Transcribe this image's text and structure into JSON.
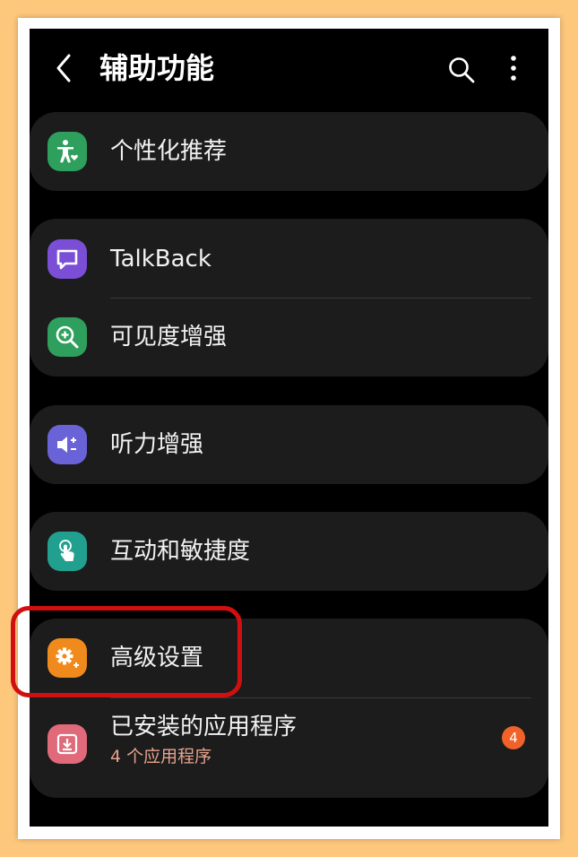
{
  "header": {
    "title": "辅助功能",
    "back_icon": "chevron-left-icon",
    "search_icon": "search-icon",
    "more_icon": "more-vertical-icon"
  },
  "groups": [
    {
      "items": [
        {
          "label": "个性化推荐",
          "icon": "accessibility-heart-icon",
          "icon_color": "#2e9f5c"
        }
      ]
    },
    {
      "items": [
        {
          "label": "TalkBack",
          "icon": "talkback-icon",
          "icon_color": "#7a4fd6"
        },
        {
          "label": "可见度增强",
          "icon": "zoom-in-icon",
          "icon_color": "#2e9f5c"
        }
      ]
    },
    {
      "items": [
        {
          "label": "听力增强",
          "icon": "volume-plus-minus-icon",
          "icon_color": "#6a63d8"
        }
      ]
    },
    {
      "items": [
        {
          "label": "互动和敏捷度",
          "icon": "touch-hand-icon",
          "icon_color": "#22a08f"
        }
      ]
    },
    {
      "items": [
        {
          "label": "高级设置",
          "icon": "gear-plus-icon",
          "icon_color": "#f08a1c"
        },
        {
          "label": "已安装的应用程序",
          "sublabel": "4 个应用程序",
          "badge": "4",
          "icon": "download-icon",
          "icon_color": "#e06a7a"
        }
      ]
    }
  ],
  "colors": {
    "badge": "#f0622a",
    "highlight_border": "#d01010",
    "sublabel": "#e6a38c"
  }
}
